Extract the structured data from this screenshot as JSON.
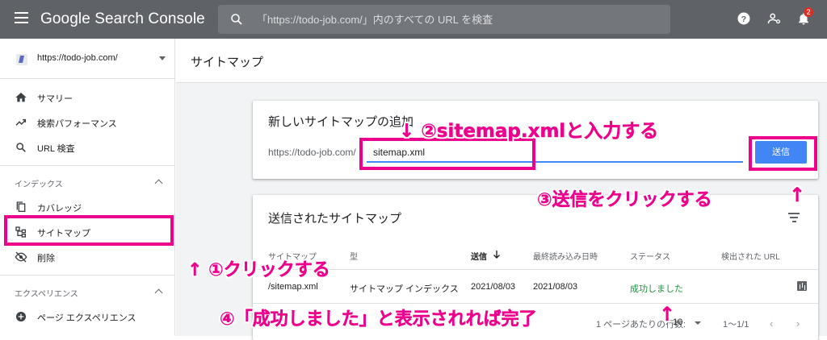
{
  "app": {
    "title": "Google Search Console"
  },
  "search": {
    "placeholder": "「https://todo-job.com/」内のすべての URL を検査"
  },
  "topbar": {
    "notification_count": "2"
  },
  "sidebar": {
    "property": "https://todo-job.com/",
    "items": [
      {
        "label": "サマリー",
        "icon": "home-icon"
      },
      {
        "label": "検索パフォーマンス",
        "icon": "trending-up-icon"
      },
      {
        "label": "URL 検査",
        "icon": "search-icon"
      }
    ],
    "index_section": {
      "title": "インデックス",
      "items": [
        {
          "label": "カバレッジ",
          "icon": "copy-icon"
        },
        {
          "label": "サイトマップ",
          "icon": "sitemap-icon"
        },
        {
          "label": "削除",
          "icon": "eye-off-icon"
        }
      ]
    },
    "experience_section": {
      "title": "エクスペリエンス",
      "items": [
        {
          "label": "ページ エクスペリエンス",
          "icon": "add-circle-icon"
        }
      ]
    }
  },
  "page": {
    "title": "サイトマップ"
  },
  "add_card": {
    "title": "新しいサイトマップの追加",
    "url_prefix": "https://todo-job.com/",
    "input_value": "sitemap.xml",
    "submit_label": "送信"
  },
  "submitted_card": {
    "title": "送信されたサイトマップ",
    "columns": [
      "サイトマップ",
      "型",
      "送信",
      "最終読み込み日時",
      "ステータス",
      "検出された URL"
    ],
    "rows": [
      {
        "sitemap": "/sitemap.xml",
        "type": "サイトマップ インデックス",
        "submitted": "2021/08/03",
        "last_read": "2021/08/03",
        "status": "成功しました"
      }
    ],
    "pager": {
      "rows_label": "1 ページあたりの行数:",
      "rows_value": "10",
      "range": "1〜1/1"
    }
  },
  "annotations": {
    "step1": "↑ ①クリックする",
    "step2": "↓ ②sitemap.xmlと入力する",
    "step3": "③送信をクリックする",
    "step3_arrow": "↑",
    "step4": "④「成功しました」と表示されれば完了",
    "step4_arrow": "↑"
  },
  "colors": {
    "accent": "#4285f4",
    "annotation": "#ec008c",
    "success": "#1e8e3e",
    "topbar": "#5f6368"
  }
}
